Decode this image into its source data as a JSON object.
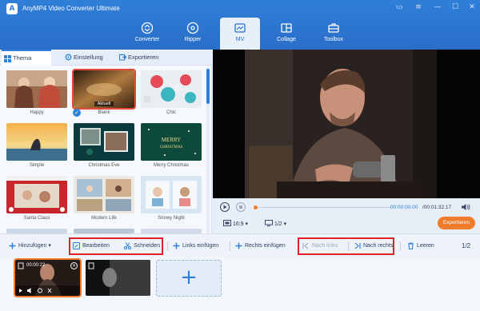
{
  "app": {
    "title": "AnyMP4 Video Converter Ultimate",
    "logo_letter": "A"
  },
  "window_controls": [
    {
      "name": "chat-icon",
      "glyph": "▭"
    },
    {
      "name": "menu-icon",
      "glyph": "≡"
    },
    {
      "name": "minimize-icon",
      "glyph": "—"
    },
    {
      "name": "maximize-icon",
      "glyph": "☐"
    },
    {
      "name": "close-icon",
      "glyph": "✕"
    }
  ],
  "nav": {
    "converter": "Converter",
    "ripper": "Ripper",
    "mv": "MV",
    "collage": "Collage",
    "toolbox": "Toolbox",
    "active": "MV"
  },
  "tabs": {
    "thema": "Thema",
    "einstellung": "Einstellung",
    "exportieren": "Exportieren",
    "active": "Thema"
  },
  "themes": [
    {
      "label": "Happy"
    },
    {
      "label": "Blank",
      "selected": true,
      "badge": "Aktuell"
    },
    {
      "label": "Chic"
    },
    {
      "label": "Simple"
    },
    {
      "label": "Christmas Eve"
    },
    {
      "label": "Merry Christmas"
    },
    {
      "label": "Santa Claus"
    },
    {
      "label": "Modern Life"
    },
    {
      "label": "Snowy Night"
    }
  ],
  "theme_overlays": {
    "merry": "MERRY",
    "christmas": "CHRISTMAS"
  },
  "player": {
    "time_current": "00:00:00.00",
    "time_total": "/00:01:32.17",
    "progress": 0.0,
    "aspect": "16:9",
    "page": "1/2",
    "export_label": "Exportieren"
  },
  "toolbar": {
    "hinzufuegen": "Hinzufügen",
    "bearbeiten": "Bearbeiten",
    "schneiden": "Schneiden",
    "links_einfuegen": "Links einfügen",
    "rechts_einfuegen": "Rechts einfügen",
    "nach_links": "Nach links",
    "nach_rechts": "Nach rechts",
    "leeren": "Leeren",
    "page_indicator": "1/2"
  },
  "timeline": {
    "clip1_time": "00:00:22",
    "add_glyph": "+"
  },
  "colors": {
    "accent": "#2f7fd9",
    "export": "#f07b2b",
    "highlight_box": "#e0202a"
  }
}
